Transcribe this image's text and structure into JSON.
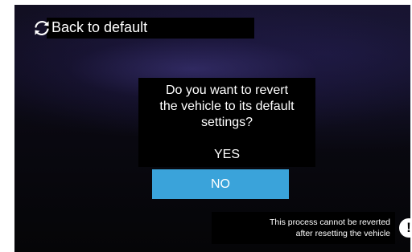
{
  "header": {
    "title": "Back to default",
    "icon": "refresh-icon"
  },
  "dialog": {
    "question": "Do you want to revert\nthe vehicle to its default\nsettings?",
    "yes_label": "YES",
    "no_label": "NO"
  },
  "warning": {
    "text": "This process cannot be reverted\nafter resetting the vehicle",
    "icon": "exclamation-icon"
  },
  "colors": {
    "accent": "#3aa3da",
    "background": "#0a0912"
  }
}
